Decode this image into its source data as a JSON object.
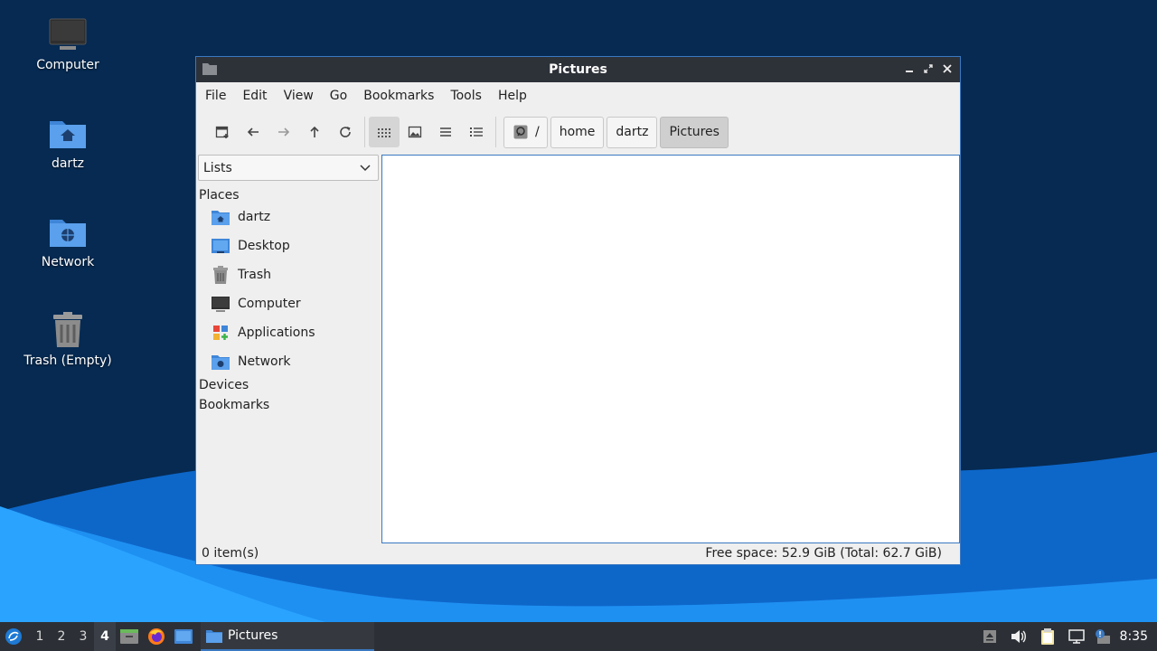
{
  "desktop": {
    "icons": [
      {
        "label": "Computer"
      },
      {
        "label": "dartz"
      },
      {
        "label": "Network"
      },
      {
        "label": "Trash (Empty)"
      }
    ]
  },
  "window": {
    "title": "Pictures",
    "menu": [
      "File",
      "Edit",
      "View",
      "Go",
      "Bookmarks",
      "Tools",
      "Help"
    ],
    "toolbar": {
      "breadcrumbs": [
        "/",
        "home",
        "dartz",
        "Pictures"
      ]
    },
    "sidebar": {
      "selector_value": "Lists",
      "places_heading": "Places",
      "places": [
        {
          "label": "dartz",
          "icon": "home-folder-icon"
        },
        {
          "label": "Desktop",
          "icon": "desktop-icon"
        },
        {
          "label": "Trash",
          "icon": "trash-icon"
        },
        {
          "label": "Computer",
          "icon": "computer-icon"
        },
        {
          "label": "Applications",
          "icon": "applications-icon"
        },
        {
          "label": "Network",
          "icon": "network-folder-icon"
        }
      ],
      "devices_heading": "Devices",
      "bookmarks_heading": "Bookmarks"
    },
    "status": {
      "items": "0 item(s)",
      "free_space": "Free space: 52.9 GiB (Total: 62.7 GiB)"
    }
  },
  "taskbar": {
    "workspaces": [
      "1",
      "2",
      "3",
      "4"
    ],
    "active_workspace": "4",
    "task_label": "Pictures",
    "clock": "8:35"
  },
  "colors": {
    "accent": "#3a79c2",
    "titlebar": "#2d3138",
    "taskbar": "#2c3036",
    "desktop_bg": "#062a52"
  }
}
